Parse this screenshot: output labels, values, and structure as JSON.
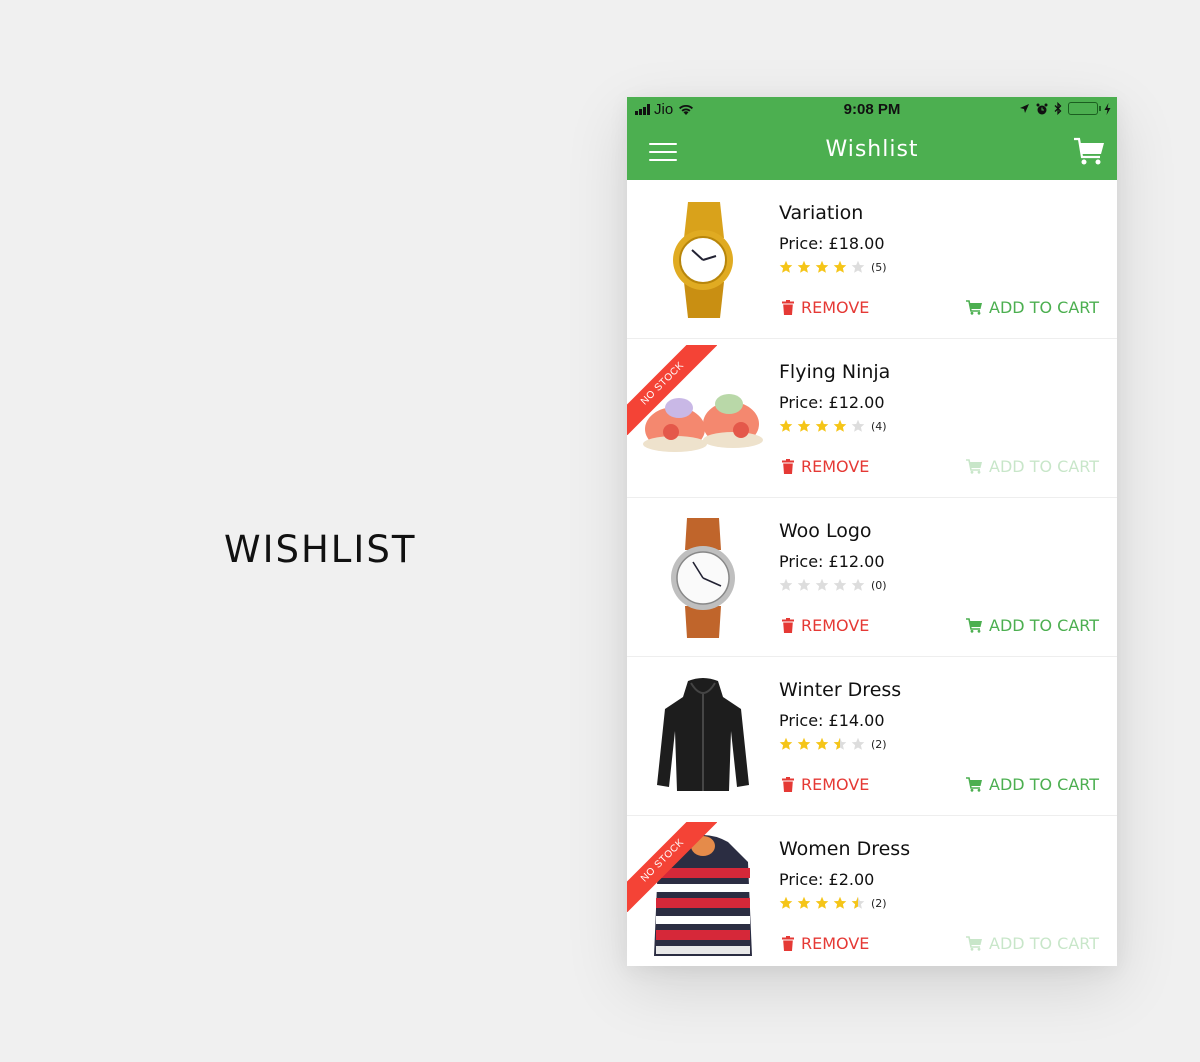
{
  "page_heading": "WISHLIST",
  "status_bar": {
    "carrier": "Jio",
    "time": "9:08 PM",
    "icons": [
      "signal-icon",
      "wifi-icon",
      "location-icon",
      "alarm-icon",
      "bluetooth-icon",
      "battery-icon",
      "charging-icon"
    ]
  },
  "app_bar": {
    "title": "Wishlist",
    "left_icon": "menu-icon",
    "right_icon": "cart-icon"
  },
  "colors": {
    "primary": "#4caf50",
    "remove": "#e53935",
    "star_filled": "#f5c518",
    "star_empty": "#dddddd",
    "badge": "#f44336"
  },
  "items": [
    {
      "name": "Variation",
      "price": "Price: £18.00",
      "rating": 4,
      "count": "(5)",
      "in_stock": true,
      "image": "gold-watch",
      "remove_label": "REMOVE",
      "cart_label": "ADD TO CART"
    },
    {
      "name": "Flying Ninja",
      "price": "Price: £12.00",
      "rating": 4,
      "count": "(4)",
      "in_stock": false,
      "badge": "NO STOCK",
      "image": "pink-shoes",
      "remove_label": "REMOVE",
      "cart_label": "ADD TO CART"
    },
    {
      "name": "Woo Logo",
      "price": "Price: £12.00",
      "rating": 0,
      "count": "(0)",
      "in_stock": true,
      "image": "leather-watch",
      "remove_label": "REMOVE",
      "cart_label": "ADD TO CART"
    },
    {
      "name": "Winter Dress",
      "price": "Price: £14.00",
      "rating": 3.5,
      "count": "(2)",
      "in_stock": true,
      "image": "black-jacket",
      "remove_label": "REMOVE",
      "cart_label": "ADD TO CART"
    },
    {
      "name": "Women Dress",
      "price": "Price: £2.00",
      "rating": 4.5,
      "count": "(2)",
      "in_stock": false,
      "badge": "NO STOCK",
      "image": "striped-hoodie",
      "remove_label": "REMOVE",
      "cart_label": "ADD TO CART"
    }
  ]
}
